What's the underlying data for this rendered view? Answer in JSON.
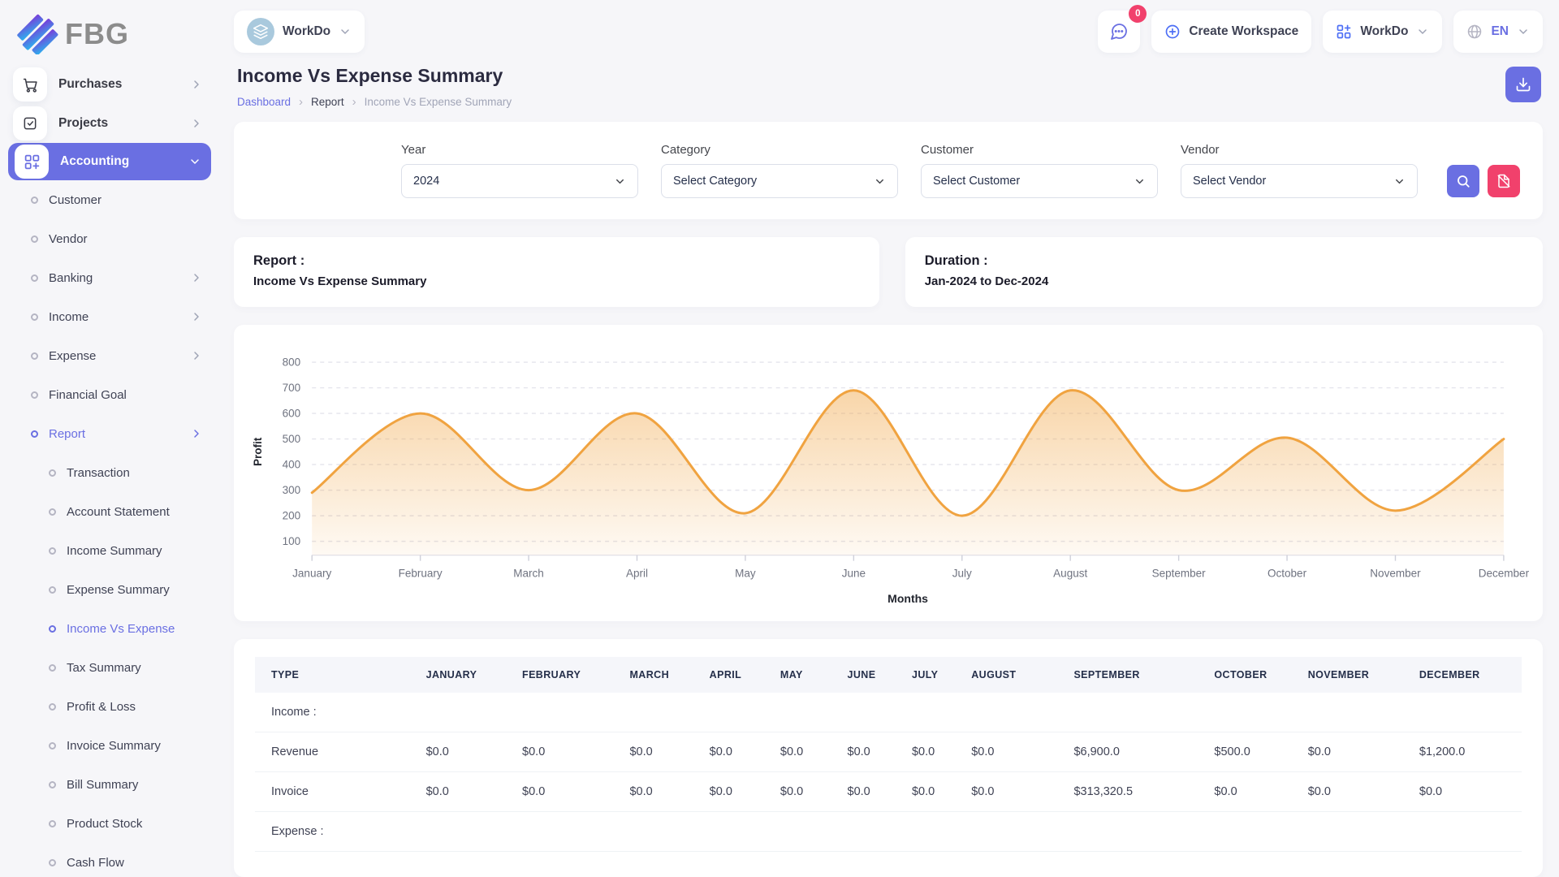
{
  "brand": {
    "logo_text": "FBG"
  },
  "topbar": {
    "workspace_switcher_label": "WorkDo",
    "messages_badge": "0",
    "create_workspace_label": "Create Workspace",
    "app_menu_label": "WorkDo",
    "language": "EN"
  },
  "sidebar": {
    "items": [
      {
        "label": "Purchases",
        "level": 0,
        "icon": "cart",
        "chevron": "right"
      },
      {
        "label": "Projects",
        "level": 0,
        "icon": "check",
        "chevron": "right"
      },
      {
        "label": "Accounting",
        "level": 0,
        "icon": "grid",
        "chevron": "down",
        "active": true
      },
      {
        "label": "Customer",
        "level": 1
      },
      {
        "label": "Vendor",
        "level": 1
      },
      {
        "label": "Banking",
        "level": 1,
        "chevron": "right"
      },
      {
        "label": "Income",
        "level": 1,
        "chevron": "right"
      },
      {
        "label": "Expense",
        "level": 1,
        "chevron": "right"
      },
      {
        "label": "Financial Goal",
        "level": 1
      },
      {
        "label": "Report",
        "level": 1,
        "chevron": "right",
        "active_link": true
      },
      {
        "label": "Transaction",
        "level": 2
      },
      {
        "label": "Account Statement",
        "level": 2
      },
      {
        "label": "Income Summary",
        "level": 2
      },
      {
        "label": "Expense Summary",
        "level": 2
      },
      {
        "label": "Income Vs Expense",
        "level": 2,
        "active_link": true
      },
      {
        "label": "Tax Summary",
        "level": 2
      },
      {
        "label": "Profit & Loss",
        "level": 2
      },
      {
        "label": "Invoice Summary",
        "level": 2
      },
      {
        "label": "Bill Summary",
        "level": 2
      },
      {
        "label": "Product Stock",
        "level": 2
      },
      {
        "label": "Cash Flow",
        "level": 2
      }
    ]
  },
  "page": {
    "title": "Income Vs Expense Summary",
    "breadcrumb": [
      "Dashboard",
      "Report",
      "Income Vs Expense Summary"
    ]
  },
  "filters": {
    "year": {
      "label": "Year",
      "value": "2024"
    },
    "category": {
      "label": "Category",
      "value": "Select Category"
    },
    "customer": {
      "label": "Customer",
      "value": "Select Customer"
    },
    "vendor": {
      "label": "Vendor",
      "value": "Select Vendor"
    }
  },
  "summary_cards": [
    {
      "label": "Report :",
      "value": "Income Vs Expense Summary"
    },
    {
      "label": "Duration :",
      "value": "Jan-2024 to Dec-2024"
    }
  ],
  "chart_data": {
    "type": "area",
    "x": [
      "January",
      "February",
      "March",
      "April",
      "May",
      "June",
      "July",
      "August",
      "September",
      "October",
      "November",
      "December"
    ],
    "series": [
      {
        "name": "Profit",
        "values": [
          290,
          600,
          300,
          600,
          210,
          690,
          200,
          690,
          300,
          505,
          220,
          500
        ]
      }
    ],
    "xlabel": "Months",
    "ylabel": "Profit",
    "ylim": [
      100,
      800
    ],
    "yticks": [
      100,
      200,
      300,
      400,
      500,
      600,
      700,
      800
    ],
    "grid": true,
    "legend": "none",
    "line_color": "#f0a340",
    "fill_color": "rgba(240,163,64,0.45)"
  },
  "table": {
    "columns": [
      "TYPE",
      "JANUARY",
      "FEBRUARY",
      "MARCH",
      "APRIL",
      "MAY",
      "JUNE",
      "JULY",
      "AUGUST",
      "SEPTEMBER",
      "OCTOBER",
      "NOVEMBER",
      "DECEMBER"
    ],
    "sections": [
      {
        "group": "Income :",
        "rows": [
          {
            "type": "Revenue",
            "values": [
              "$0.0",
              "$0.0",
              "$0.0",
              "$0.0",
              "$0.0",
              "$0.0",
              "$0.0",
              "$0.0",
              "$6,900.0",
              "$500.0",
              "$0.0",
              "$1,200.0"
            ]
          },
          {
            "type": "Invoice",
            "values": [
              "$0.0",
              "$0.0",
              "$0.0",
              "$0.0",
              "$0.0",
              "$0.0",
              "$0.0",
              "$0.0",
              "$313,320.5",
              "$0.0",
              "$0.0",
              "$0.0"
            ]
          }
        ]
      },
      {
        "group": "Expense :",
        "rows": []
      }
    ]
  },
  "colors": {
    "accent": "#6a6fe2",
    "danger": "#f1416c",
    "chart_orange": "#f0a340"
  }
}
